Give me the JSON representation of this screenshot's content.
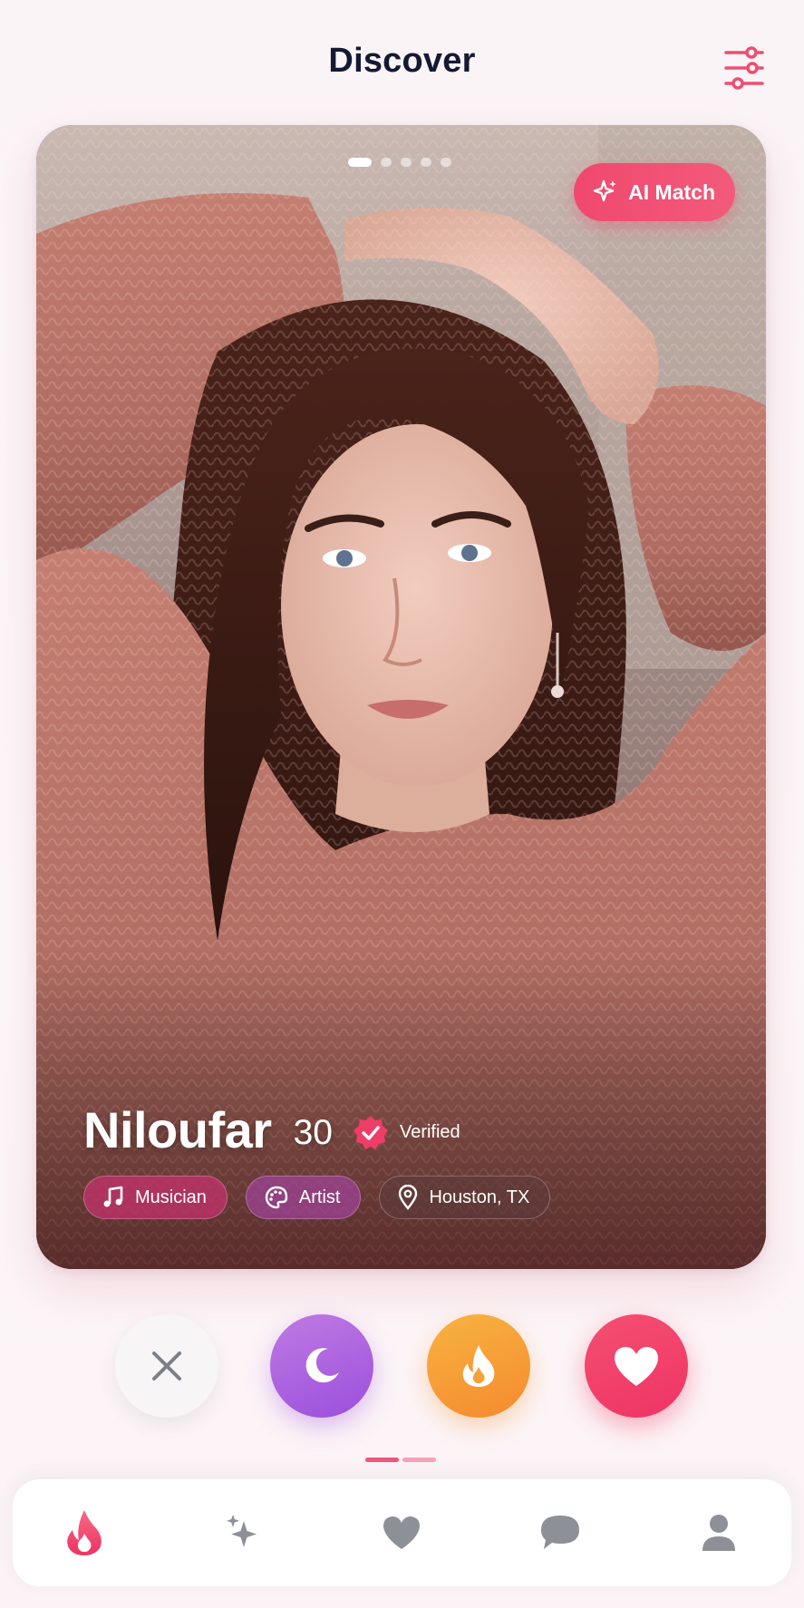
{
  "header": {
    "title": "Discover"
  },
  "card": {
    "photo_index": 1,
    "photo_count": 5,
    "ai_match_label": "AI Match",
    "name": "Niloufar",
    "age": "30",
    "verified_label": "Verified",
    "tags": [
      {
        "icon": "music-note-icon",
        "label": "Musician"
      },
      {
        "icon": "palette-icon",
        "label": "Artist"
      },
      {
        "icon": "location-pin-icon",
        "label": "Houston, TX"
      }
    ]
  },
  "actions": [
    "close-icon",
    "moon-icon",
    "flame-icon",
    "heart-icon"
  ],
  "colors": {
    "accent": "#F0486F",
    "purple": "#A057DD",
    "orange": "#F69A33",
    "text": "#141A33"
  },
  "nav": {
    "items": [
      {
        "icon": "flame-icon",
        "active": true
      },
      {
        "icon": "sparkle-icon",
        "active": false
      },
      {
        "icon": "heart-icon",
        "active": false
      },
      {
        "icon": "chat-icon",
        "active": false
      },
      {
        "icon": "profile-icon",
        "active": false
      }
    ]
  }
}
